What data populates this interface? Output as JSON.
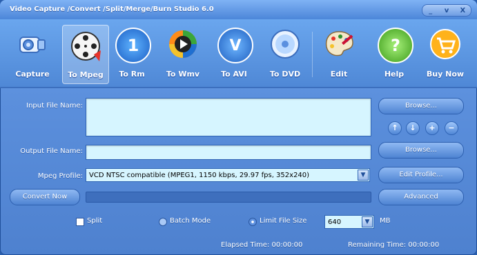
{
  "window": {
    "title": "Video Capture /Convert /Split/Merge/Burn Studio 6.0",
    "controls": [
      "_",
      "v",
      "X"
    ]
  },
  "toolbar": {
    "items": [
      {
        "label": "Capture",
        "icon": "camera-icon"
      },
      {
        "label": "To Mpeg",
        "icon": "film-reel-icon",
        "active": true
      },
      {
        "label": "To Rm",
        "icon": "realmedia-icon"
      },
      {
        "label": "To Wmv",
        "icon": "windows-media-icon"
      },
      {
        "label": "To AVI",
        "icon": "avi-icon"
      },
      {
        "label": "To DVD",
        "icon": "dvd-icon"
      },
      {
        "label": "Edit",
        "icon": "palette-icon"
      },
      {
        "label": "Help",
        "icon": "help-icon"
      },
      {
        "label": "Buy Now",
        "icon": "cart-icon"
      }
    ]
  },
  "form": {
    "input_label": "Input File Name:",
    "output_label": "Output File Name:",
    "profile_label": "Mpeg Profile:",
    "profile_value": "VCD NTSC compatible (MPEG1, 1150 kbps, 29.97 fps, 352x240)",
    "convert_label": "Convert Now"
  },
  "buttons": {
    "browse1": "Browse...",
    "browse2": "Browse...",
    "edit_profile": "Edit Profile...",
    "advanced": "Advanced"
  },
  "list_controls": {
    "up": "↑",
    "down": "↓",
    "add": "+",
    "remove": "−"
  },
  "options": {
    "split": "Split",
    "batch_mode": "Batch Mode",
    "limit_size": "Limit File Size",
    "size_value": "640",
    "size_unit": "MB"
  },
  "status": {
    "elapsed": "Elapsed Time: 00:00:00",
    "remaining": "Remaining Time: 00:00:00"
  },
  "colors": {
    "accent": "#4f88d6",
    "field_bg": "#d6f5ff"
  }
}
